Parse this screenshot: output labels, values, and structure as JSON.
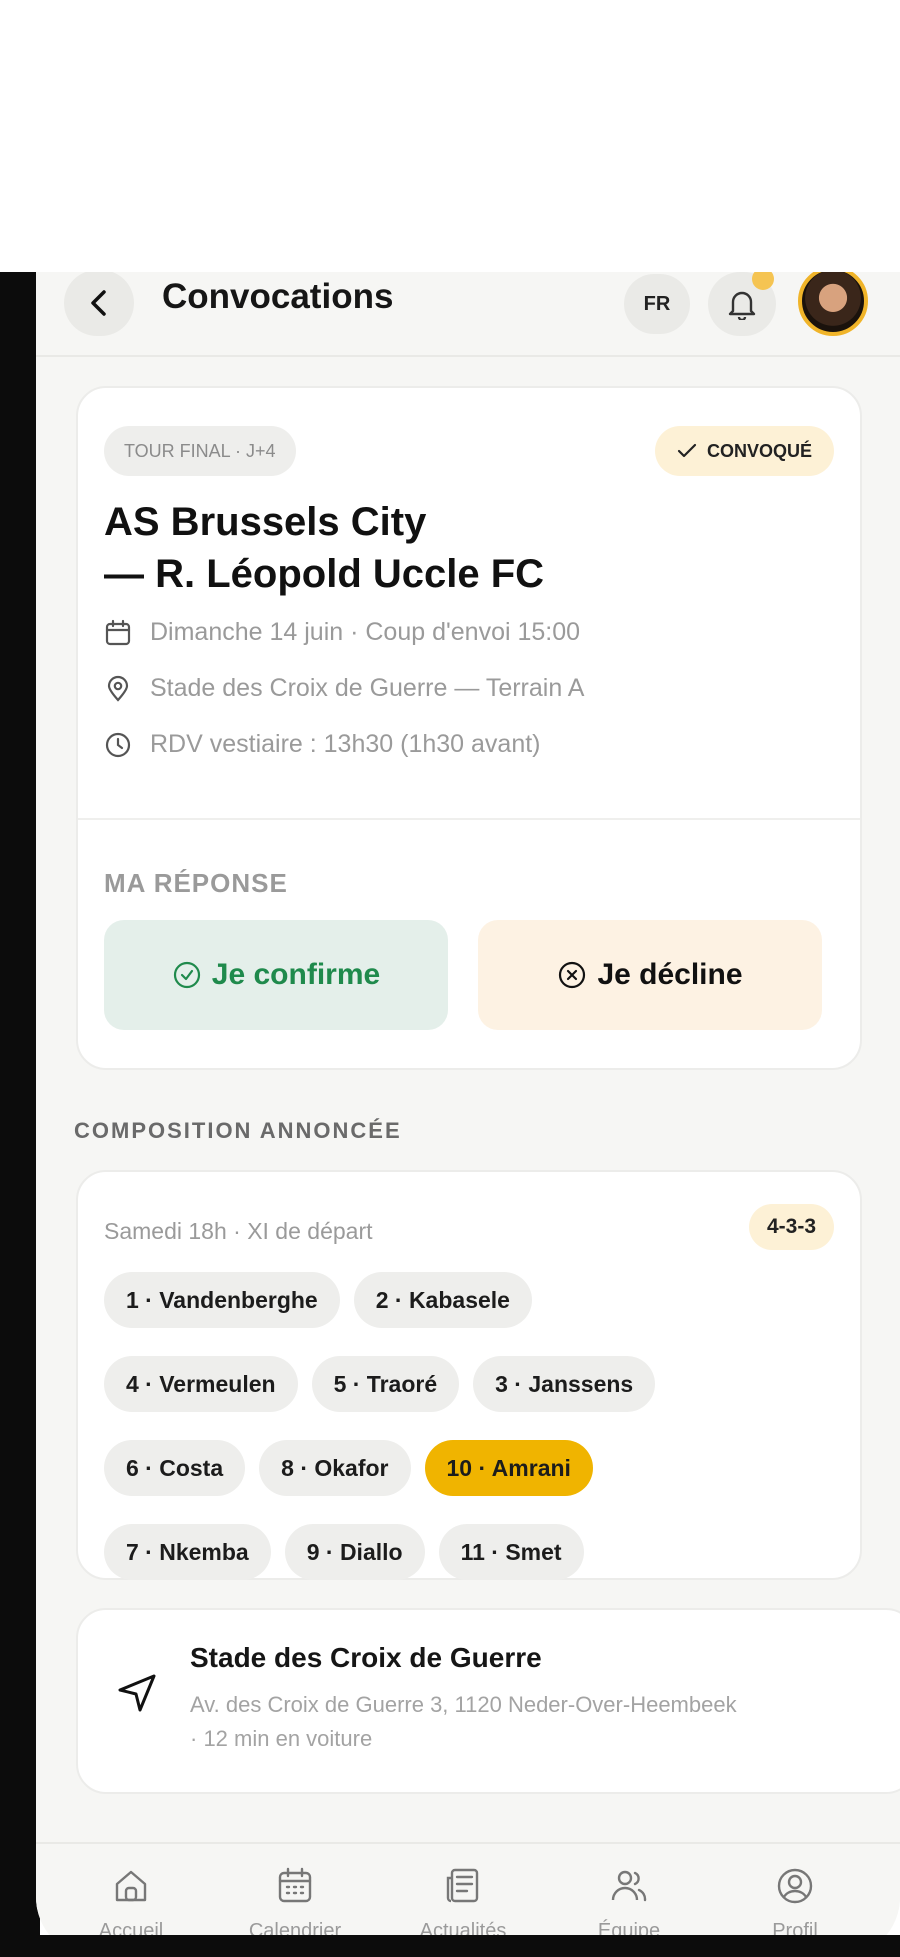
{
  "header": {
    "title": "Convocations",
    "lang": "FR"
  },
  "match": {
    "round_tag": "TOUR FINAL · J+4",
    "status_badge": "CONVOQUÉ",
    "title_line1": "AS Brussels City",
    "title_line2": "— R. Léopold Uccle FC",
    "date_info": "Dimanche 14 juin · Coup d'envoi 15:00",
    "location_info": "Stade des Croix de Guerre — Terrain A",
    "meeting_info": "RDV vestiaire : 13h30 (1h30 avant)",
    "response_title": "MA RÉPONSE",
    "confirm_label": "Je confirme",
    "decline_label": "Je décline"
  },
  "composition": {
    "section_title": "COMPOSITION ANNONCÉE",
    "subtitle": "Samedi 18h · XI de départ",
    "formation": "4-3-3",
    "players": [
      "1 · Vandenberghe",
      "2 · Kabasele",
      "4 · Vermeulen",
      "5 · Traoré",
      "3 · Janssens",
      "6 · Costa",
      "8 · Okafor",
      "10 · Amrani",
      "7 · Nkemba",
      "9 · Diallo",
      "11 · Smet"
    ]
  },
  "venue": {
    "name": "Stade des Croix de Guerre",
    "address": "Av. des Croix de Guerre 3, 1120 Neder-Over-Heembeek · 12 min en voiture"
  },
  "nav": {
    "items": [
      {
        "label": "Accueil",
        "icon": "home-icon"
      },
      {
        "label": "Calendrier",
        "icon": "calendar-icon"
      },
      {
        "label": "Actualités",
        "icon": "news-icon"
      },
      {
        "label": "Équipe",
        "icon": "team-icon"
      },
      {
        "label": "Profil",
        "icon": "profile-icon"
      }
    ]
  },
  "colors": {
    "accent": "#f0b400",
    "confirm_green": "#1f8a4c",
    "confirm_bg": "#e4efea",
    "decline_bg": "#fdf2e3"
  }
}
